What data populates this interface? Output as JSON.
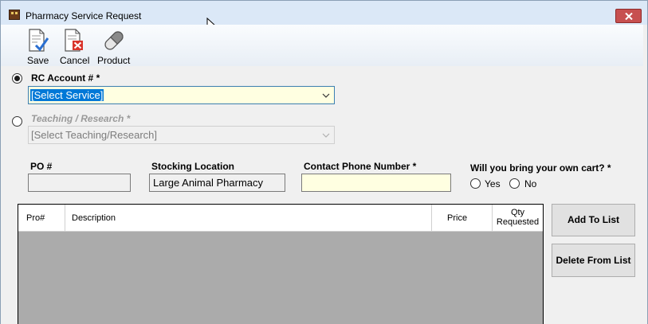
{
  "window": {
    "title": "Pharmacy Service Request"
  },
  "toolbar": {
    "save_label": "Save",
    "cancel_label": "Cancel",
    "product_label": "Product"
  },
  "account": {
    "rc_label": "RC Account # *",
    "rc_selected": true,
    "rc_value": "[Select Service]",
    "teaching_label": "Teaching / Research *",
    "teaching_selected": false,
    "teaching_value": "[Select Teaching/Research]"
  },
  "fields": {
    "po_label": "PO #",
    "po_value": "",
    "stocking_label": "Stocking Location",
    "stocking_value": "Large Animal Pharmacy",
    "phone_label": "Contact Phone Number *",
    "phone_value": "",
    "cart_label": "Will you bring your own cart? *",
    "cart_yes": "Yes",
    "cart_no": "No"
  },
  "grid": {
    "columns": [
      "Pro#",
      "Description",
      "Price",
      "Qty\nRequested"
    ],
    "rows": []
  },
  "buttons": {
    "add_to_list": "Add To List",
    "delete_from_list": "Delete From List"
  }
}
